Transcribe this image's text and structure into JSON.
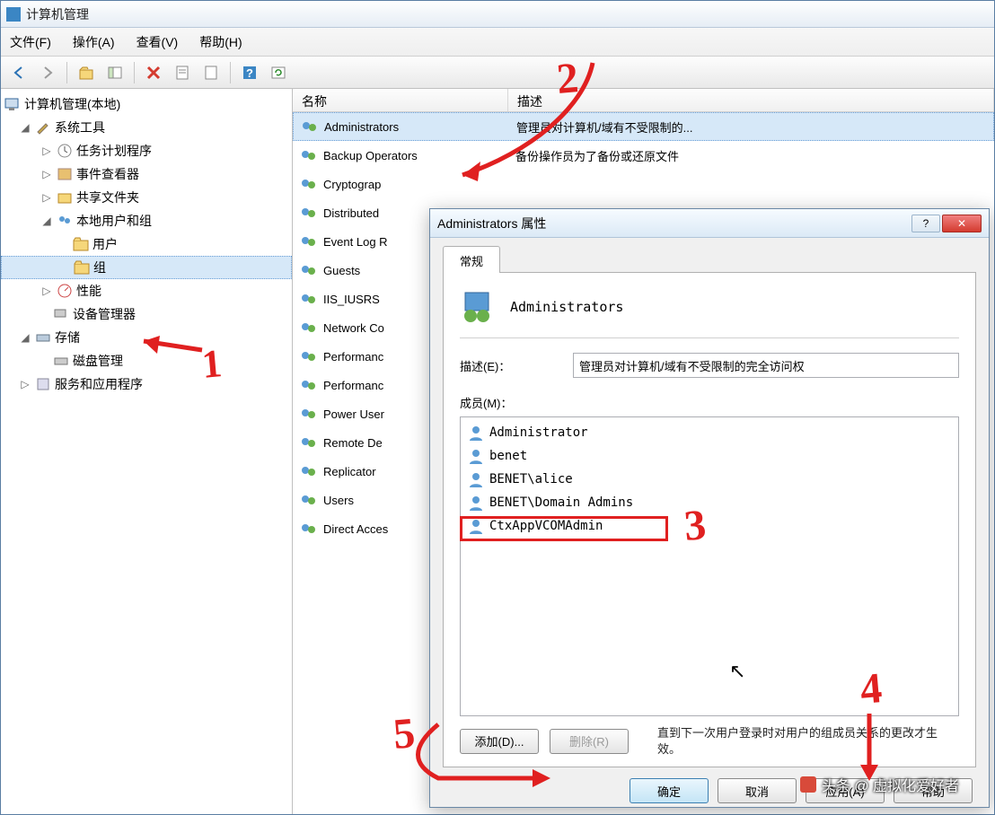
{
  "window": {
    "title": "计算机管理"
  },
  "menu": {
    "file": "文件(F)",
    "action": "操作(A)",
    "view": "查看(V)",
    "help": "帮助(H)"
  },
  "tree": {
    "root": "计算机管理(本地)",
    "sys_tools": "系统工具",
    "task_sched": "任务计划程序",
    "event_viewer": "事件查看器",
    "shared_folders": "共享文件夹",
    "local_users_groups": "本地用户和组",
    "users_node": "用户",
    "groups_node": "组",
    "perf": "性能",
    "devmgr": "设备管理器",
    "storage": "存储",
    "diskmgr": "磁盘管理",
    "services_apps": "服务和应用程序"
  },
  "list": {
    "col_name": "名称",
    "col_desc": "描述",
    "rows": [
      {
        "name": "Administrators",
        "desc": "管理员对计算机/域有不受限制的..."
      },
      {
        "name": "Backup Operators",
        "desc": "备份操作员为了备份或还原文件"
      },
      {
        "name": "Cryptograp",
        "desc": ""
      },
      {
        "name": "Distributed",
        "desc": ""
      },
      {
        "name": "Event Log R",
        "desc": ""
      },
      {
        "name": "Guests",
        "desc": ""
      },
      {
        "name": "IIS_IUSRS",
        "desc": ""
      },
      {
        "name": "Network Co",
        "desc": ""
      },
      {
        "name": "Performanc",
        "desc": ""
      },
      {
        "name": "Performanc",
        "desc": ""
      },
      {
        "name": "Power User",
        "desc": ""
      },
      {
        "name": "Remote De",
        "desc": ""
      },
      {
        "name": "Replicator",
        "desc": ""
      },
      {
        "name": "Users",
        "desc": ""
      },
      {
        "name": "Direct Acces",
        "desc": ""
      }
    ]
  },
  "dialog": {
    "title": "Administrators 属性",
    "tab_general": "常规",
    "group_name": "Administrators",
    "desc_label": "描述(E)：",
    "desc_value": "管理员对计算机/域有不受限制的完全访问权",
    "members_label": "成员(M)：",
    "members": [
      "Administrator",
      "benet",
      "BENET\\alice",
      "BENET\\Domain Admins",
      "CtxAppVCOMAdmin"
    ],
    "add": "添加(D)...",
    "remove": "删除(R)",
    "note": "直到下一次用户登录时对用户的组成员关系的更改才生效。",
    "ok": "确定",
    "cancel": "取消",
    "apply": "应用(A)",
    "help_btn": "帮助"
  },
  "annotations": {
    "n1": "1",
    "n2": "2",
    "n3": "3",
    "n4": "4",
    "n5": "5"
  },
  "watermark": "头条 @ 虚拟化爱好者"
}
